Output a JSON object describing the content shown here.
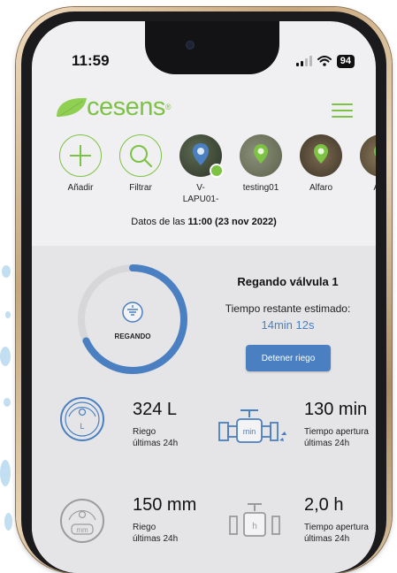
{
  "status_bar": {
    "time": "11:59",
    "battery": "94"
  },
  "header": {
    "logo_text": "cesens",
    "logo_mark": "®",
    "brand_color": "#7cc243",
    "menu_icon": "hamburger-menu-icon"
  },
  "devices": [
    {
      "label": "Añadir",
      "icon": "plus-icon"
    },
    {
      "label": "Filtrar",
      "icon": "search-icon"
    },
    {
      "label": "V-\nLAPU01-",
      "icon": "map-pin-icon"
    },
    {
      "label": "testing01",
      "icon": "map-pin-icon"
    },
    {
      "label": "Alfaro",
      "icon": "map-pin-icon"
    },
    {
      "label": "Alfa",
      "icon": "map-pin-icon"
    }
  ],
  "datos": {
    "prefix": "Datos de las ",
    "timestamp": "11:00 (23 nov 2022)"
  },
  "irrigation": {
    "status_label": "REGANDO",
    "progress": 0.68,
    "accent_color": "#4a7fc1",
    "title": "Regando válvula 1",
    "remaining_label": "Tiempo restante estimado:",
    "remaining_value": "14min 12s",
    "stop_button": "Detener riego"
  },
  "stats": [
    {
      "value": "324 L",
      "label_1": "Riego",
      "label_2": "últimas 24h",
      "icon": "water-meter-icon"
    },
    {
      "value": "130 min",
      "label_1": "Tiempo apertura",
      "label_2": "últimas 24h",
      "icon": "valve-icon"
    },
    {
      "value": "150 mm",
      "label_1": "Riego",
      "label_2": "últimas 24h",
      "icon": "rain-gauge-icon"
    },
    {
      "value": "2,0 h",
      "label_1": "Tiempo apertura",
      "label_2": "últimas 24h",
      "icon": "valve-hours-icon"
    }
  ],
  "icon_units": {
    "meter": "L",
    "valve": "min",
    "gauge": "mm",
    "valve_h": "h"
  }
}
